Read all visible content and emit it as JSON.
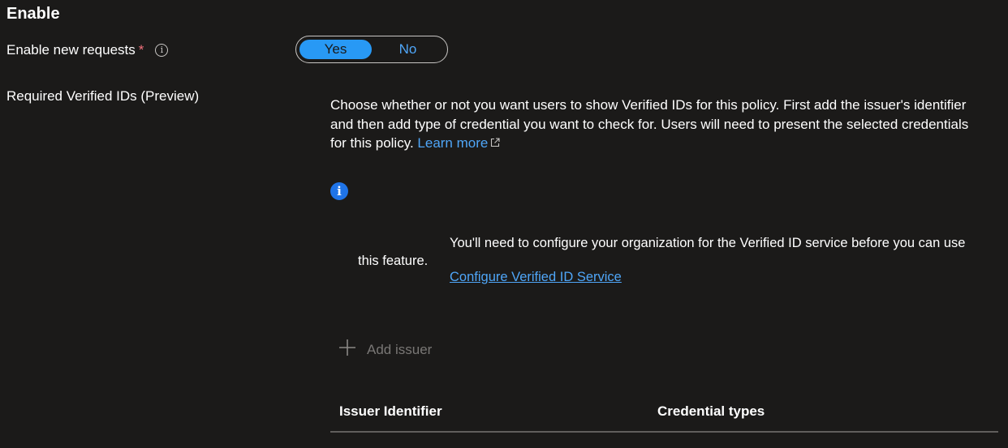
{
  "section": {
    "title": "Enable"
  },
  "enable_requests": {
    "label": "Enable new requests",
    "required_marker": "*",
    "info_icon": "info-circle-icon",
    "toggle": {
      "yes": "Yes",
      "no": "No",
      "selected": "Yes"
    }
  },
  "verified_ids": {
    "label": "Required Verified IDs (Preview)",
    "description": "Choose whether or not you want users to show Verified IDs for this policy. First add the issuer's identifier and then add type of credential you want to check for. Users will need to present the selected credentials for this policy.",
    "learn_more": "Learn more",
    "external_link_icon": "external-link-icon",
    "info_icon": "info-filled-icon",
    "notice": "You'll need to configure your organization for the Verified ID service before you can use this feature.",
    "configure_link": "Configure Verified ID Service",
    "add_issuer": "Add issuer",
    "add_icon": "plus-icon",
    "table": {
      "columns": [
        "Issuer Identifier",
        "Credential types"
      ]
    }
  },
  "colors": {
    "background": "#1b1a19",
    "accent": "#2899f5",
    "link": "#4fa6f8",
    "required": "#f1707b",
    "info_badge": "#1f74e8",
    "disabled_text": "#797775"
  }
}
